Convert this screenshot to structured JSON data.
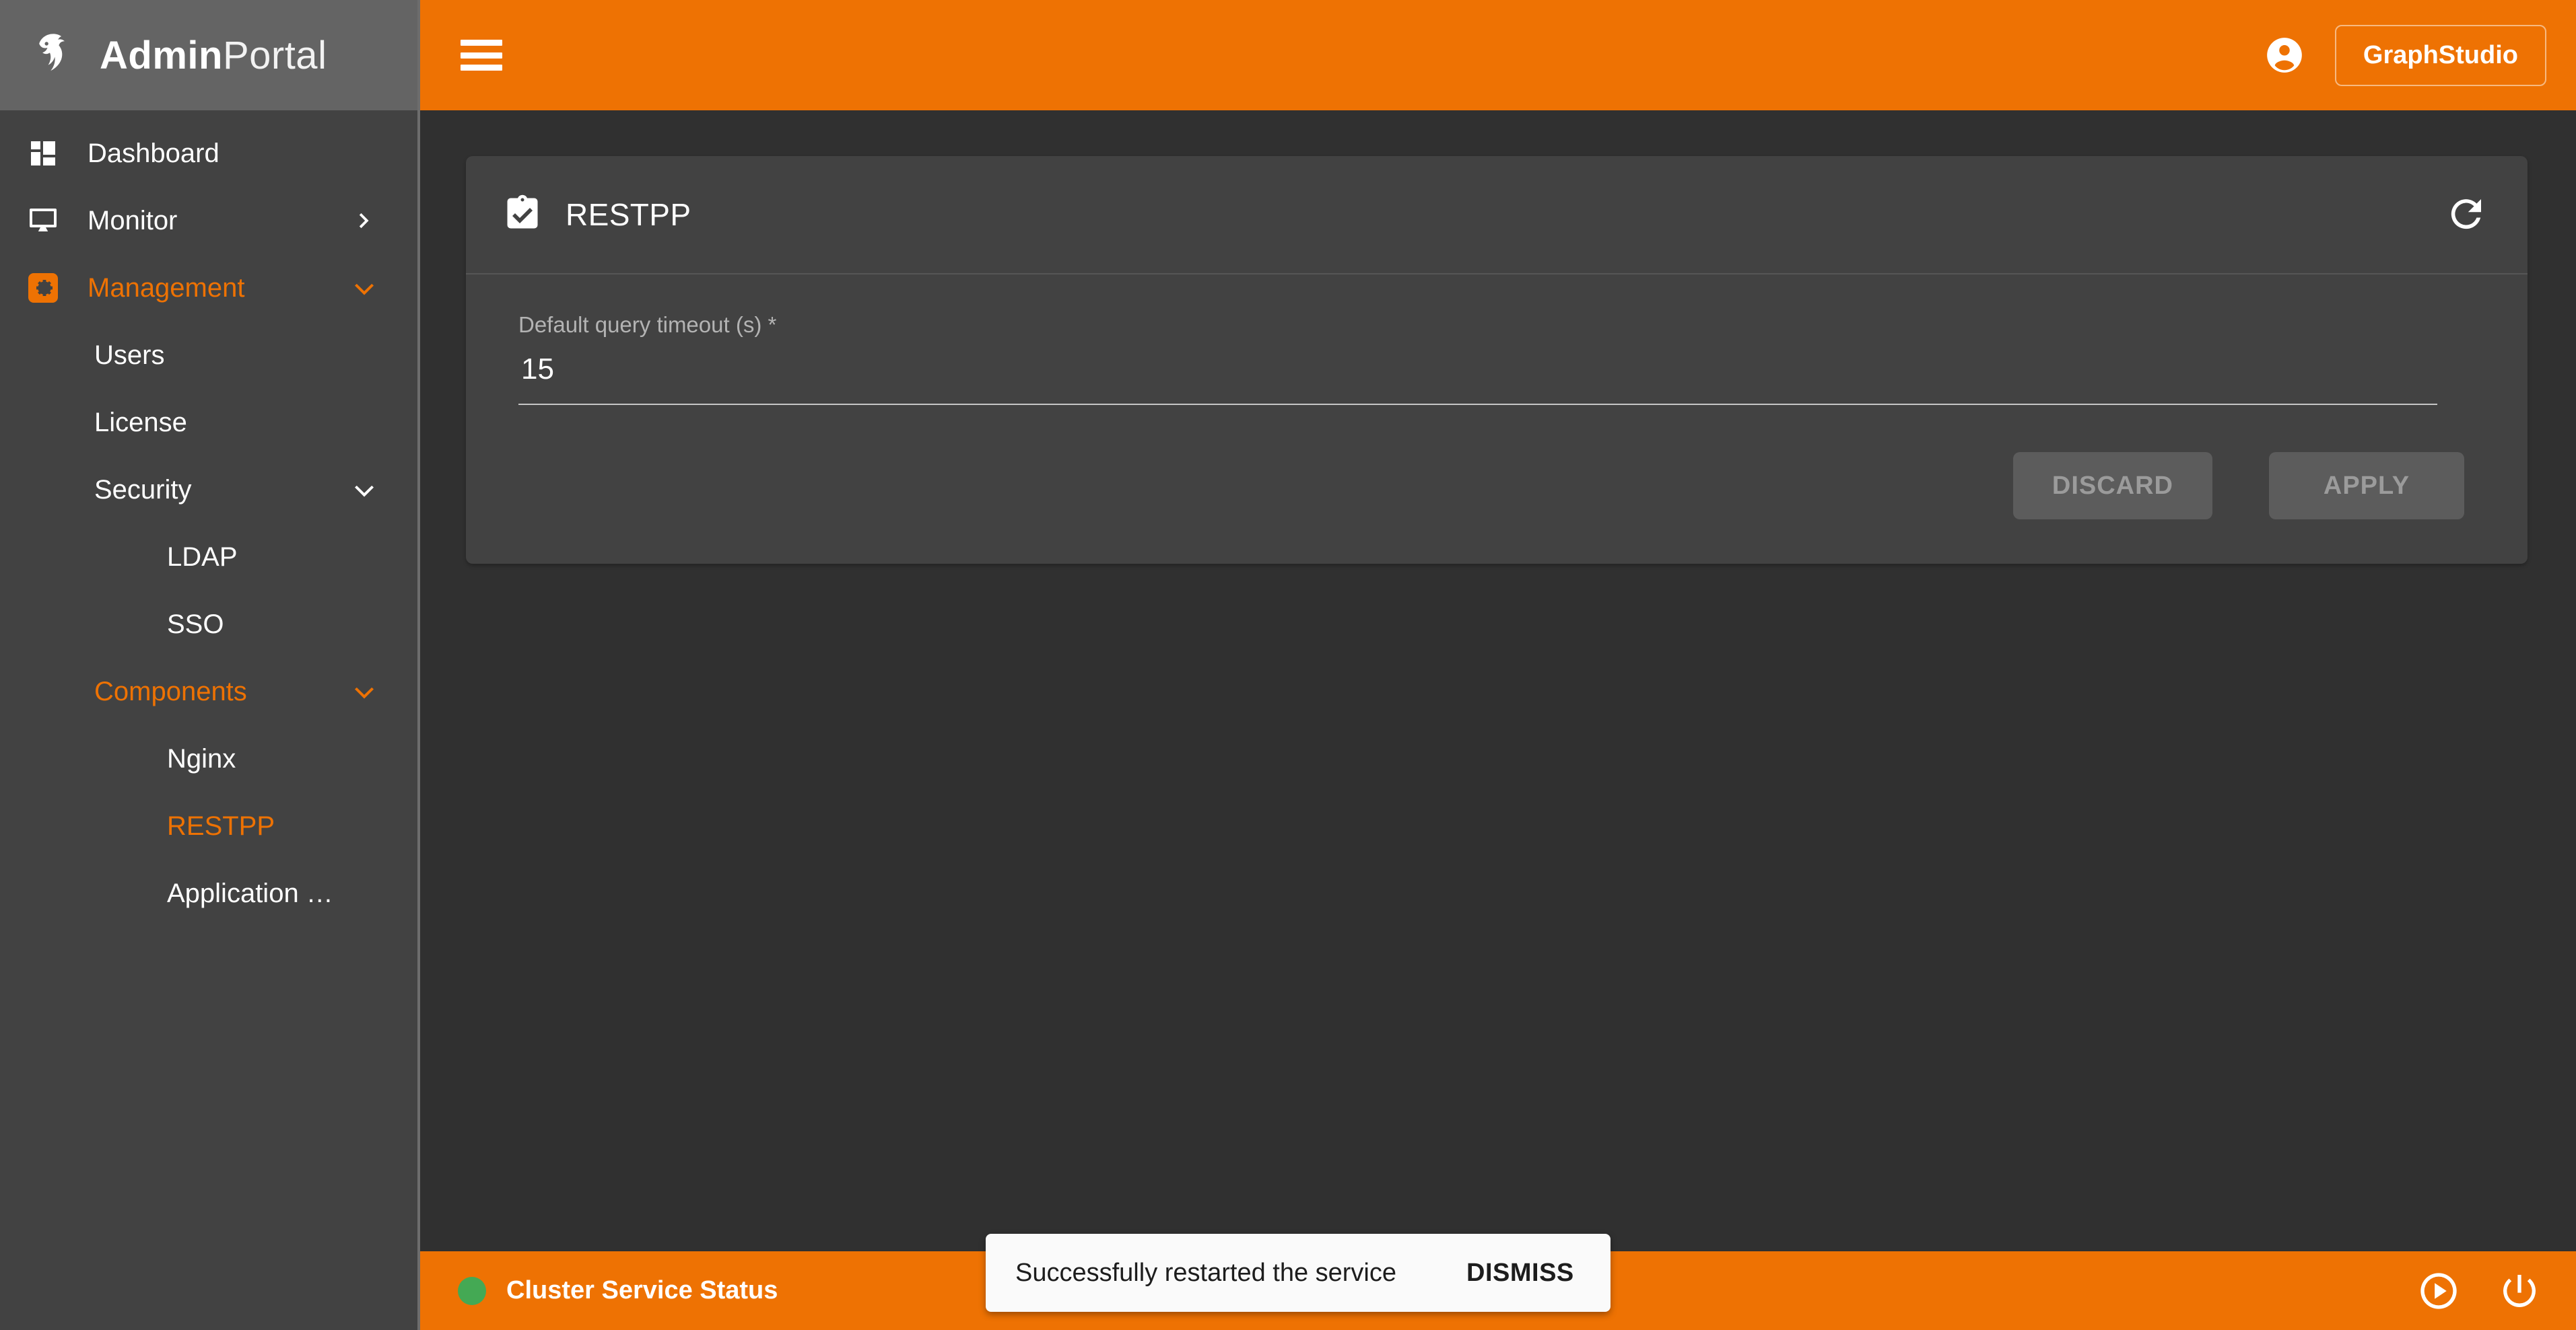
{
  "brand": {
    "name_bold": "Admin",
    "name_light": "Portal",
    "logo_icon": "tiger-head-logo-icon"
  },
  "colors": {
    "accent": "#ee7203",
    "sidebar_bg": "#424242",
    "page_bg": "#303030",
    "card_bg": "#424242",
    "status_ok": "#44a954"
  },
  "sidebar": {
    "items": [
      {
        "label": "Dashboard",
        "icon": "dashboard-grid-icon",
        "level": 1,
        "active": false,
        "chevron": ""
      },
      {
        "label": "Monitor",
        "icon": "monitor-display-icon",
        "level": 1,
        "active": false,
        "chevron": "chevron-right-icon"
      },
      {
        "label": "Management",
        "icon": "gear-settings-icon",
        "level": 1,
        "active": true,
        "chevron": "chevron-down-icon"
      },
      {
        "label": "Users",
        "icon": "",
        "level": 2,
        "active": false,
        "chevron": ""
      },
      {
        "label": "License",
        "icon": "",
        "level": 2,
        "active": false,
        "chevron": ""
      },
      {
        "label": "Security",
        "icon": "",
        "level": 2,
        "active": false,
        "chevron": "chevron-down-icon"
      },
      {
        "label": "LDAP",
        "icon": "",
        "level": 3,
        "active": false,
        "chevron": ""
      },
      {
        "label": "SSO",
        "icon": "",
        "level": 3,
        "active": false,
        "chevron": ""
      },
      {
        "label": "Components",
        "icon": "",
        "level": 2,
        "active": true,
        "chevron": "chevron-down-icon"
      },
      {
        "label": "Nginx",
        "icon": "",
        "level": 3,
        "active": false,
        "chevron": ""
      },
      {
        "label": "RESTPP",
        "icon": "",
        "level": 3,
        "active": true,
        "chevron": ""
      },
      {
        "label": "Application Serv…",
        "icon": "",
        "level": 3,
        "active": false,
        "chevron": ""
      }
    ]
  },
  "topbar": {
    "menu_icon": "hamburger-menu-icon",
    "account_icon": "account-circle-icon",
    "graphstudio_label": "GraphStudio"
  },
  "card": {
    "icon": "clipboard-check-icon",
    "title": "RESTPP",
    "refresh_icon": "refresh-restart-icon",
    "field": {
      "label": "Default query timeout (s) *",
      "value": "15",
      "placeholder": "Default query timeout (s)"
    },
    "discard_label": "DISCARD",
    "apply_label": "APPLY"
  },
  "bottombar": {
    "status_label": "Cluster Service Status",
    "status_color": "#44a954",
    "start_icon": "play-circle-icon",
    "power_icon": "power-off-icon"
  },
  "snackbar": {
    "message": "Successfully restarted the service",
    "action_label": "DISMISS"
  }
}
